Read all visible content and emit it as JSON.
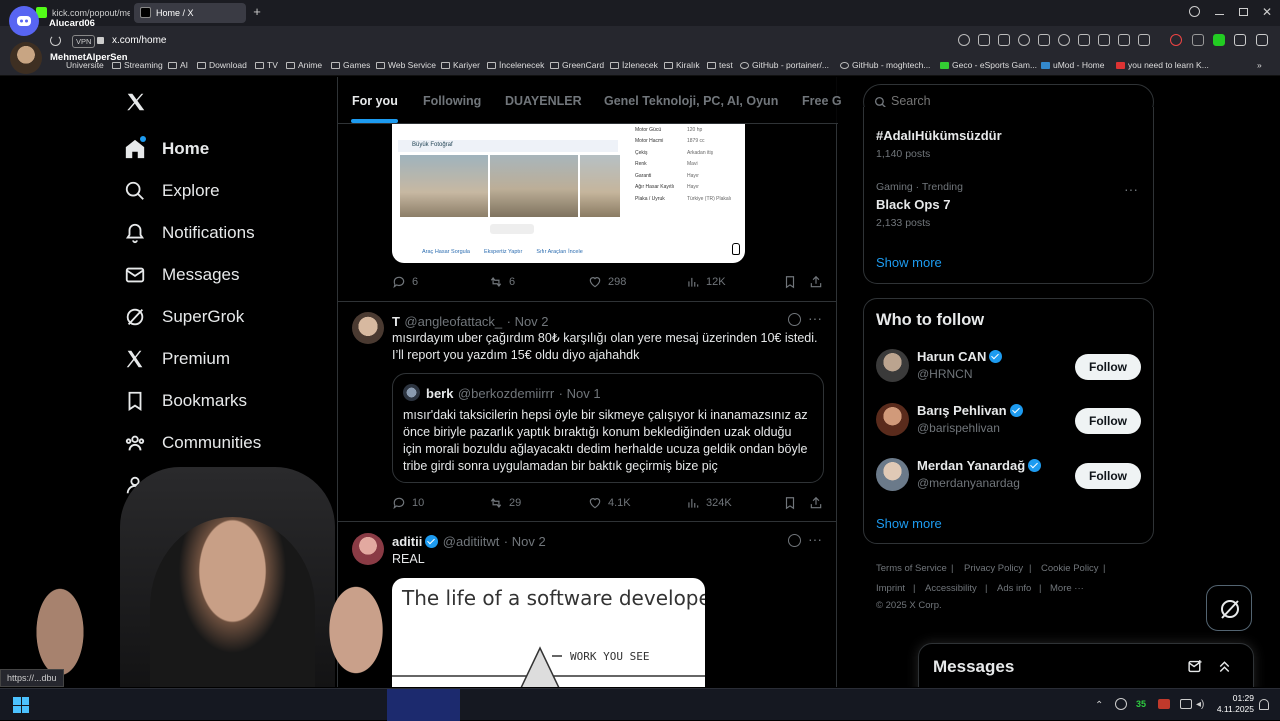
{
  "browser": {
    "tabs": [
      {
        "title": "kick.com/popout/mehmet"
      },
      {
        "title": "Home / X"
      }
    ],
    "url": "x.com/home",
    "vpn_label": "VPN",
    "bookmarks": [
      "Universite",
      "Streaming",
      "AI",
      "Download",
      "TV",
      "Anime",
      "Games",
      "Web Service",
      "Kariyer",
      "İncelenecek",
      "GreenCard",
      "İzlenecek",
      "Kiralık",
      "test",
      "GitHub - portainer/...",
      "GitHub - moghtech...",
      "Geco - eSports Gam...",
      "uMod - Home",
      "you need to learn K..."
    ],
    "overlay_user": "Alucard06",
    "overlay_user2": "MehmetAlperSen",
    "status_url": "https://...dbu"
  },
  "nav": {
    "home": "Home",
    "explore": "Explore",
    "notifications": "Notifications",
    "messages": "Messages",
    "supergrok": "SuperGrok",
    "premium": "Premium",
    "bookmarks": "Bookmarks",
    "communities": "Communities",
    "profile_partial": "P"
  },
  "feed_tabs": [
    "For you",
    "Following",
    "DUAYENLER",
    "Genel Teknoloji, PC, AI, Oyun",
    "Free G"
  ],
  "tweet1": {
    "image_rows": [
      [
        "Motor Gücü",
        "120 hp"
      ],
      [
        "Motor Hacmi",
        "1879 cc"
      ],
      [
        "Çekiş",
        "Arkadan itiş"
      ],
      [
        "Renk",
        "Mavi"
      ],
      [
        "Garanti",
        "Hayır"
      ],
      [
        "Ağır Hasar Kayıtlı",
        "Hayır"
      ],
      [
        "Plaka / Uyruk",
        "Türkiye (TR) Plakalı"
      ]
    ],
    "image_caption": "Büyük Fotoğraf",
    "image_links": [
      "Araç Hasar Sorgula",
      "Ekspertiz Yaptır",
      "Sıfır Araçları İncele"
    ],
    "replies": "6",
    "reposts": "6",
    "likes": "298",
    "views": "12K"
  },
  "tweet2": {
    "name": "T",
    "handle": "@angleofattack_",
    "date": "· Nov 2",
    "text": "mısırdayım uber çağırdım 80₺ karşılığı olan yere mesaj üzerinden 10€ istedi. I’ll report you yazdım 15€ oldu diyo ajahahdk",
    "quote": {
      "name": "berk",
      "handle": "@berkozdemiirrr",
      "date": "· Nov 1",
      "text": "mısır'daki taksicilerin hepsi öyle bir sikmeye çalışıyor ki inanamazsınız az önce biriyle pazarlık yaptık bıraktığı konum beklediğinden uzak olduğu için morali bozuldu ağlayacaktı dedim herhalde ucuza geldik ondan böyle tribe girdi sonra uygulamadan bir baktık geçirmiş bize piç"
    },
    "replies": "10",
    "reposts": "29",
    "likes": "4.1K",
    "views": "324K"
  },
  "tweet3": {
    "name": "aditii",
    "handle": "@aditiitwt",
    "date": "· Nov 2",
    "text": "REAL",
    "image_title": "The life of a software developer",
    "image_label": "WORK YOU SEE"
  },
  "search": {
    "placeholder": "Search"
  },
  "trends": [
    {
      "category": "",
      "name": "#AdalıHükümsüzdür",
      "posts": "1,140 posts"
    },
    {
      "category": "Gaming · Trending",
      "name": "Black Ops 7",
      "posts": "2,133 posts"
    }
  ],
  "trends_show_more": "Show more",
  "who_to_follow": {
    "title": "Who to follow",
    "users": [
      {
        "name": "Harun CAN",
        "handle": "@HRNCN",
        "button": "Follow"
      },
      {
        "name": "Barış Pehlivan",
        "handle": "@barispehlivan",
        "button": "Follow"
      },
      {
        "name": "Merdan Yanardağ",
        "handle": "@merdanyanardag",
        "button": "Follow"
      }
    ],
    "show_more": "Show more"
  },
  "footer": {
    "links": [
      "Terms of Service",
      "Privacy Policy",
      "Cookie Policy",
      "Imprint",
      "Accessibility",
      "Ads info",
      "More ···"
    ],
    "copyright": "© 2025 X Corp."
  },
  "messages_drawer": {
    "title": "Messages"
  },
  "taskbar": {
    "time": "01:29",
    "date": "4.11.2025",
    "badge": "35"
  },
  "colors": {
    "accent": "#1d9bf0",
    "background": "#000000",
    "border": "#2f3336",
    "muted": "#71767b"
  }
}
